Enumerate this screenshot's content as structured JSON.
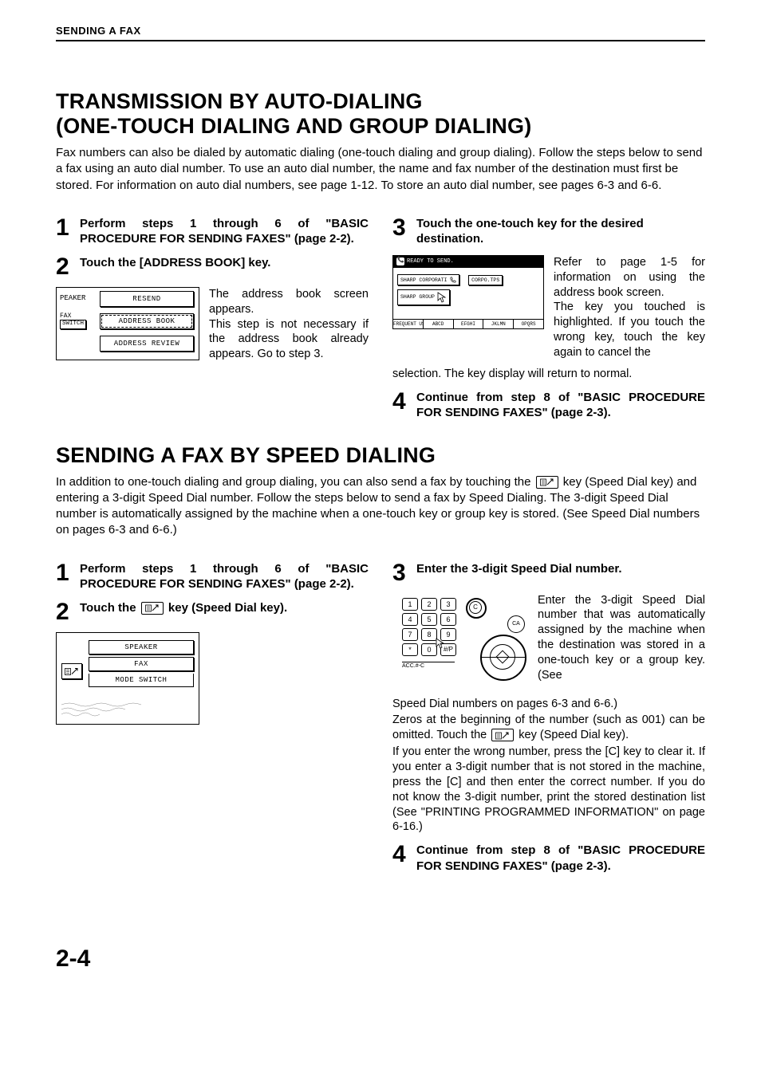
{
  "header": {
    "section_label": "SENDING A FAX"
  },
  "section1": {
    "title_line1": "TRANSMISSION BY AUTO-DIALING",
    "title_line2": " (ONE-TOUCH DIALING AND GROUP DIALING)",
    "intro": "Fax numbers can also be dialed by automatic dialing (one-touch dialing and group dialing). Follow the steps below to send a fax using an auto dial number. To use an auto dial number, the name and fax number of the destination must first be stored. For information on auto dial numbers, see page 1-12. To store an auto dial number, see pages 6-3 and 6-6.",
    "steps": {
      "s1": {
        "num": "1",
        "head": "Perform steps 1 through 6 of \"BASIC PROCEDURE FOR SENDING FAXES\" (page 2-2)."
      },
      "s2": {
        "num": "2",
        "head": "Touch the [ADDRESS BOOK] key.",
        "desc": "The address book screen appears.\nThis step is not necessary if the address book already appears. Go to step 3."
      },
      "s3": {
        "num": "3",
        "head": "Touch the one-touch key for the desired destination.",
        "desc_right": "Refer to page 1-5 for information on using the address book screen.\nThe key you touched is highlighted. If you touch the wrong key, touch the key again to cancel the",
        "desc_cont": "selection. The key display will return to normal."
      },
      "s4": {
        "num": "4",
        "head": "Continue from step 8 of \"BASIC PROCEDURE FOR SENDING FAXES\" (page 2-3)."
      }
    },
    "fig1": {
      "left1": "PEAKER",
      "btn_resend": "RESEND",
      "left2a": "FAX",
      "left2b": "SWITCH",
      "btn_addrbook": "ADDRESS BOOK",
      "btn_addrreview": "ADDRESS REVIEW"
    },
    "fig2": {
      "top": "READY TO SEND.",
      "key1": "SHARP CORPORATI",
      "key1_ext": "CORPO.TPS",
      "key2": "SHARP GROUP",
      "tabs": [
        "FREQUENT USE",
        "ABCD",
        "EFGHI",
        "JKLMN",
        "OPQRS"
      ]
    }
  },
  "section2": {
    "title": "SENDING A FAX BY SPEED DIALING",
    "intro_a": "In addition to one-touch dialing and group dialing, you can also send a fax by touching the ",
    "intro_b": " key (Speed Dial key) and entering a 3-digit Speed Dial number. Follow the steps below to send a fax by Speed Dialing. The 3-digit Speed Dial number is automatically assigned by the machine when a one-touch key or group key is stored. (See Speed Dial numbers on pages 6-3 and 6-6.)",
    "steps": {
      "s1": {
        "num": "1",
        "head": "Perform steps 1 through 6 of \"BASIC PROCEDURE FOR SENDING FAXES\" (page 2-2)."
      },
      "s2": {
        "num": "2",
        "head_a": "Touch the ",
        "head_b": " key (Speed Dial key)."
      },
      "s3": {
        "num": "3",
        "head": "Enter the 3-digit Speed Dial number.",
        "desc_right": "Enter the 3-digit Speed Dial number that was automatically assigned by the machine when the destination was stored in a one-touch key or a group key. (See",
        "desc_p2": "Speed Dial numbers on pages 6-3 and 6-6.)",
        "desc_p3a": "Zeros at the beginning of the number (such as 001) can be omitted. Touch the ",
        "desc_p3b": " key (Speed Dial key).",
        "desc_p4": "If you enter the wrong number, press the [C] key to clear it. If you enter a 3-digit number that is not stored in the machine, press the [C] and then enter the correct number. If you do not know the 3-digit number, print the stored destination list (See \"PRINTING PROGRAMMED INFORMATION\" on page 6-16.)"
      },
      "s4": {
        "num": "4",
        "head": "Continue from step 8 of \"BASIC PROCEDURE FOR SENDING FAXES\" (page 2-3)."
      }
    },
    "fig3": {
      "btn_speaker": "SPEAKER",
      "btn_fax": "FAX",
      "btn_mode": "MODE SWITCH"
    },
    "fig4": {
      "keys": [
        [
          "1",
          "2",
          "3"
        ],
        [
          "4",
          "5",
          "6"
        ],
        [
          "7",
          "8",
          "9"
        ],
        [
          "*",
          "0",
          "#/P"
        ]
      ],
      "acc": "ACC.#-C",
      "c_label": "C",
      "ca_label": "CA"
    }
  },
  "page_number": "2-4"
}
